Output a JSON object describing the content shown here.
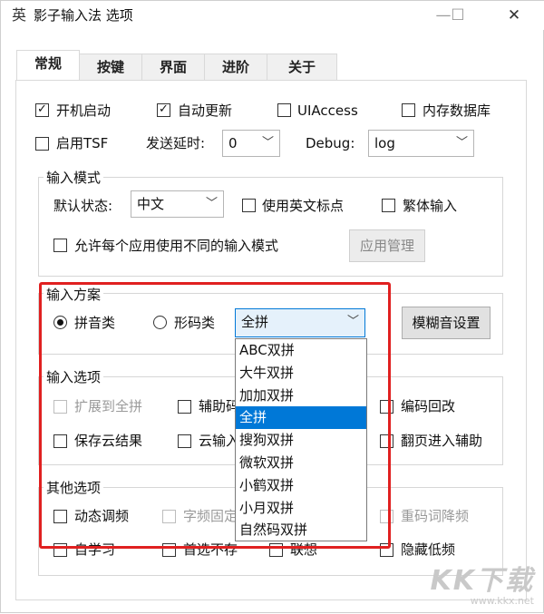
{
  "window": {
    "title": "影子输入法 选项",
    "app_icon": "英",
    "minimize_glyph": "—",
    "maximize_glyph": "☐",
    "close_glyph": "✕"
  },
  "tabs": [
    {
      "label": "常规",
      "active": true
    },
    {
      "label": "按键",
      "active": false
    },
    {
      "label": "界面",
      "active": false
    },
    {
      "label": "进阶",
      "active": false
    },
    {
      "label": "关于",
      "active": false
    }
  ],
  "general": {
    "autostart": {
      "label": "开机启动",
      "checked": true
    },
    "autoupdate": {
      "label": "自动更新",
      "checked": true
    },
    "uiaccess": {
      "label": "UIAccess",
      "checked": false
    },
    "memdb": {
      "label": "内存数据库",
      "checked": false
    },
    "tsf": {
      "label": "启用TSF",
      "checked": false
    },
    "send_delay_label": "发送延时:",
    "send_delay_value": "0",
    "debug_label": "Debug:",
    "debug_value": "log"
  },
  "input_mode": {
    "title": "输入模式",
    "default_state_label": "默认状态:",
    "default_state_value": "中文",
    "eng_punct": {
      "label": "使用英文标点",
      "checked": false
    },
    "traditional": {
      "label": "繁体输入",
      "checked": false
    },
    "per_app": {
      "label": "允许每个应用使用不同的输入模式",
      "checked": false
    },
    "app_manage_button": "应用管理"
  },
  "input_scheme": {
    "title": "输入方案",
    "pinyin_radio": {
      "label": "拼音类",
      "checked": true
    },
    "shape_radio": {
      "label": "形码类",
      "checked": false
    },
    "scheme_value": "全拼",
    "fuzzy_button": "模糊音设置",
    "options": [
      "ABC双拼",
      "大牛双拼",
      "加加双拼",
      "全拼",
      "搜狗双拼",
      "微软双拼",
      "小鹤双拼",
      "小月双拼",
      "自然码双拼"
    ],
    "selected_index": 3
  },
  "input_options": {
    "title": "输入选项",
    "expand_full": {
      "label": "扩展到全拼",
      "checked": false,
      "disabled": true
    },
    "aux_code": {
      "label": "辅助码",
      "checked": false
    },
    "code_backspace": {
      "label": "编码回改",
      "checked": false
    },
    "save_cloud": {
      "label": "保存云结果",
      "checked": false
    },
    "cloud_input": {
      "label": "云输入",
      "checked": false
    },
    "page_aux": {
      "label": "翻页进入辅助",
      "checked": false
    }
  },
  "other_options": {
    "title": "其他选项",
    "dynamic_freq": {
      "label": "动态调频",
      "checked": false
    },
    "char_freq_fixed": {
      "label": "字频固定",
      "checked": false,
      "disabled": true
    },
    "dup_code_lower": {
      "label": "重码词降频",
      "checked": false,
      "disabled": true
    },
    "self_learn": {
      "label": "自学习",
      "checked": false
    },
    "first_not_save": {
      "label": "首选不存",
      "checked": false
    },
    "association": {
      "label": "联想",
      "checked": false
    },
    "hide_low_freq": {
      "label": "隐藏低频",
      "checked": false
    }
  },
  "watermark": {
    "logo": "KK下载",
    "url": "www.kkx.net"
  },
  "colors": {
    "accent": "#0078d7",
    "highlight_border": "#e02020"
  }
}
